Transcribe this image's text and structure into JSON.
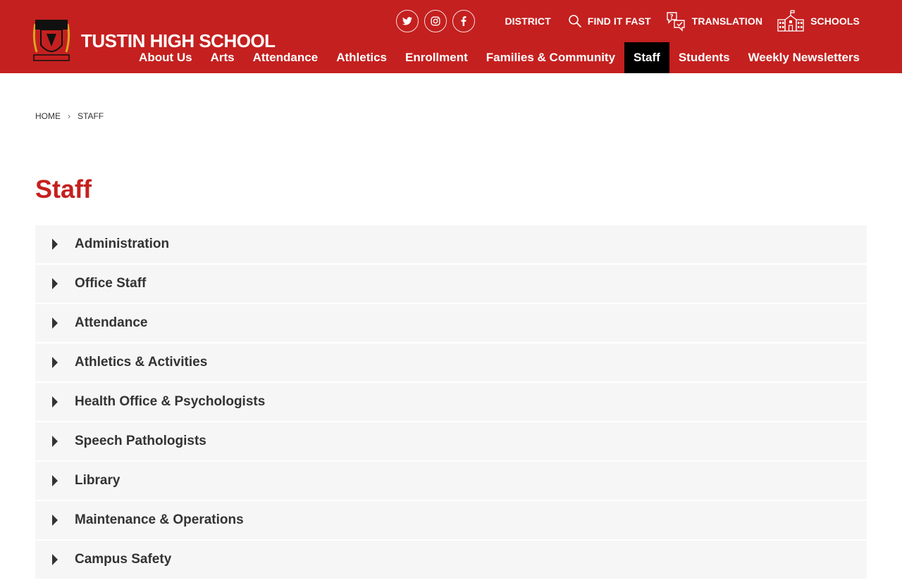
{
  "header": {
    "school_name": "TUSTIN HIGH SCHOOL",
    "brand_color": "#c4201f",
    "logo": "crest-logo"
  },
  "utility": {
    "social": [
      {
        "name": "twitter-icon"
      },
      {
        "name": "instagram-icon"
      },
      {
        "name": "facebook-icon"
      }
    ],
    "district": "DISTRICT",
    "find_it_fast": "FIND IT FAST",
    "translation": "TRANSLATION",
    "schools": "SCHOOLS"
  },
  "nav": {
    "items": [
      {
        "label": "About Us"
      },
      {
        "label": "Arts"
      },
      {
        "label": "Attendance"
      },
      {
        "label": "Athletics"
      },
      {
        "label": "Enrollment"
      },
      {
        "label": "Families & Community"
      },
      {
        "label": "Staff",
        "active": true
      },
      {
        "label": "Students"
      },
      {
        "label": "Weekly Newsletters"
      }
    ]
  },
  "breadcrumb": {
    "home": "HOME",
    "current": "STAFF"
  },
  "page": {
    "title": "Staff"
  },
  "accordion": {
    "items": [
      {
        "label": "Administration"
      },
      {
        "label": "Office Staff"
      },
      {
        "label": "Attendance"
      },
      {
        "label": "Athletics & Activities"
      },
      {
        "label": "Health Office & Psychologists"
      },
      {
        "label": "Speech Pathologists"
      },
      {
        "label": "Library"
      },
      {
        "label": "Maintenance & Operations"
      },
      {
        "label": "Campus Safety"
      }
    ]
  }
}
